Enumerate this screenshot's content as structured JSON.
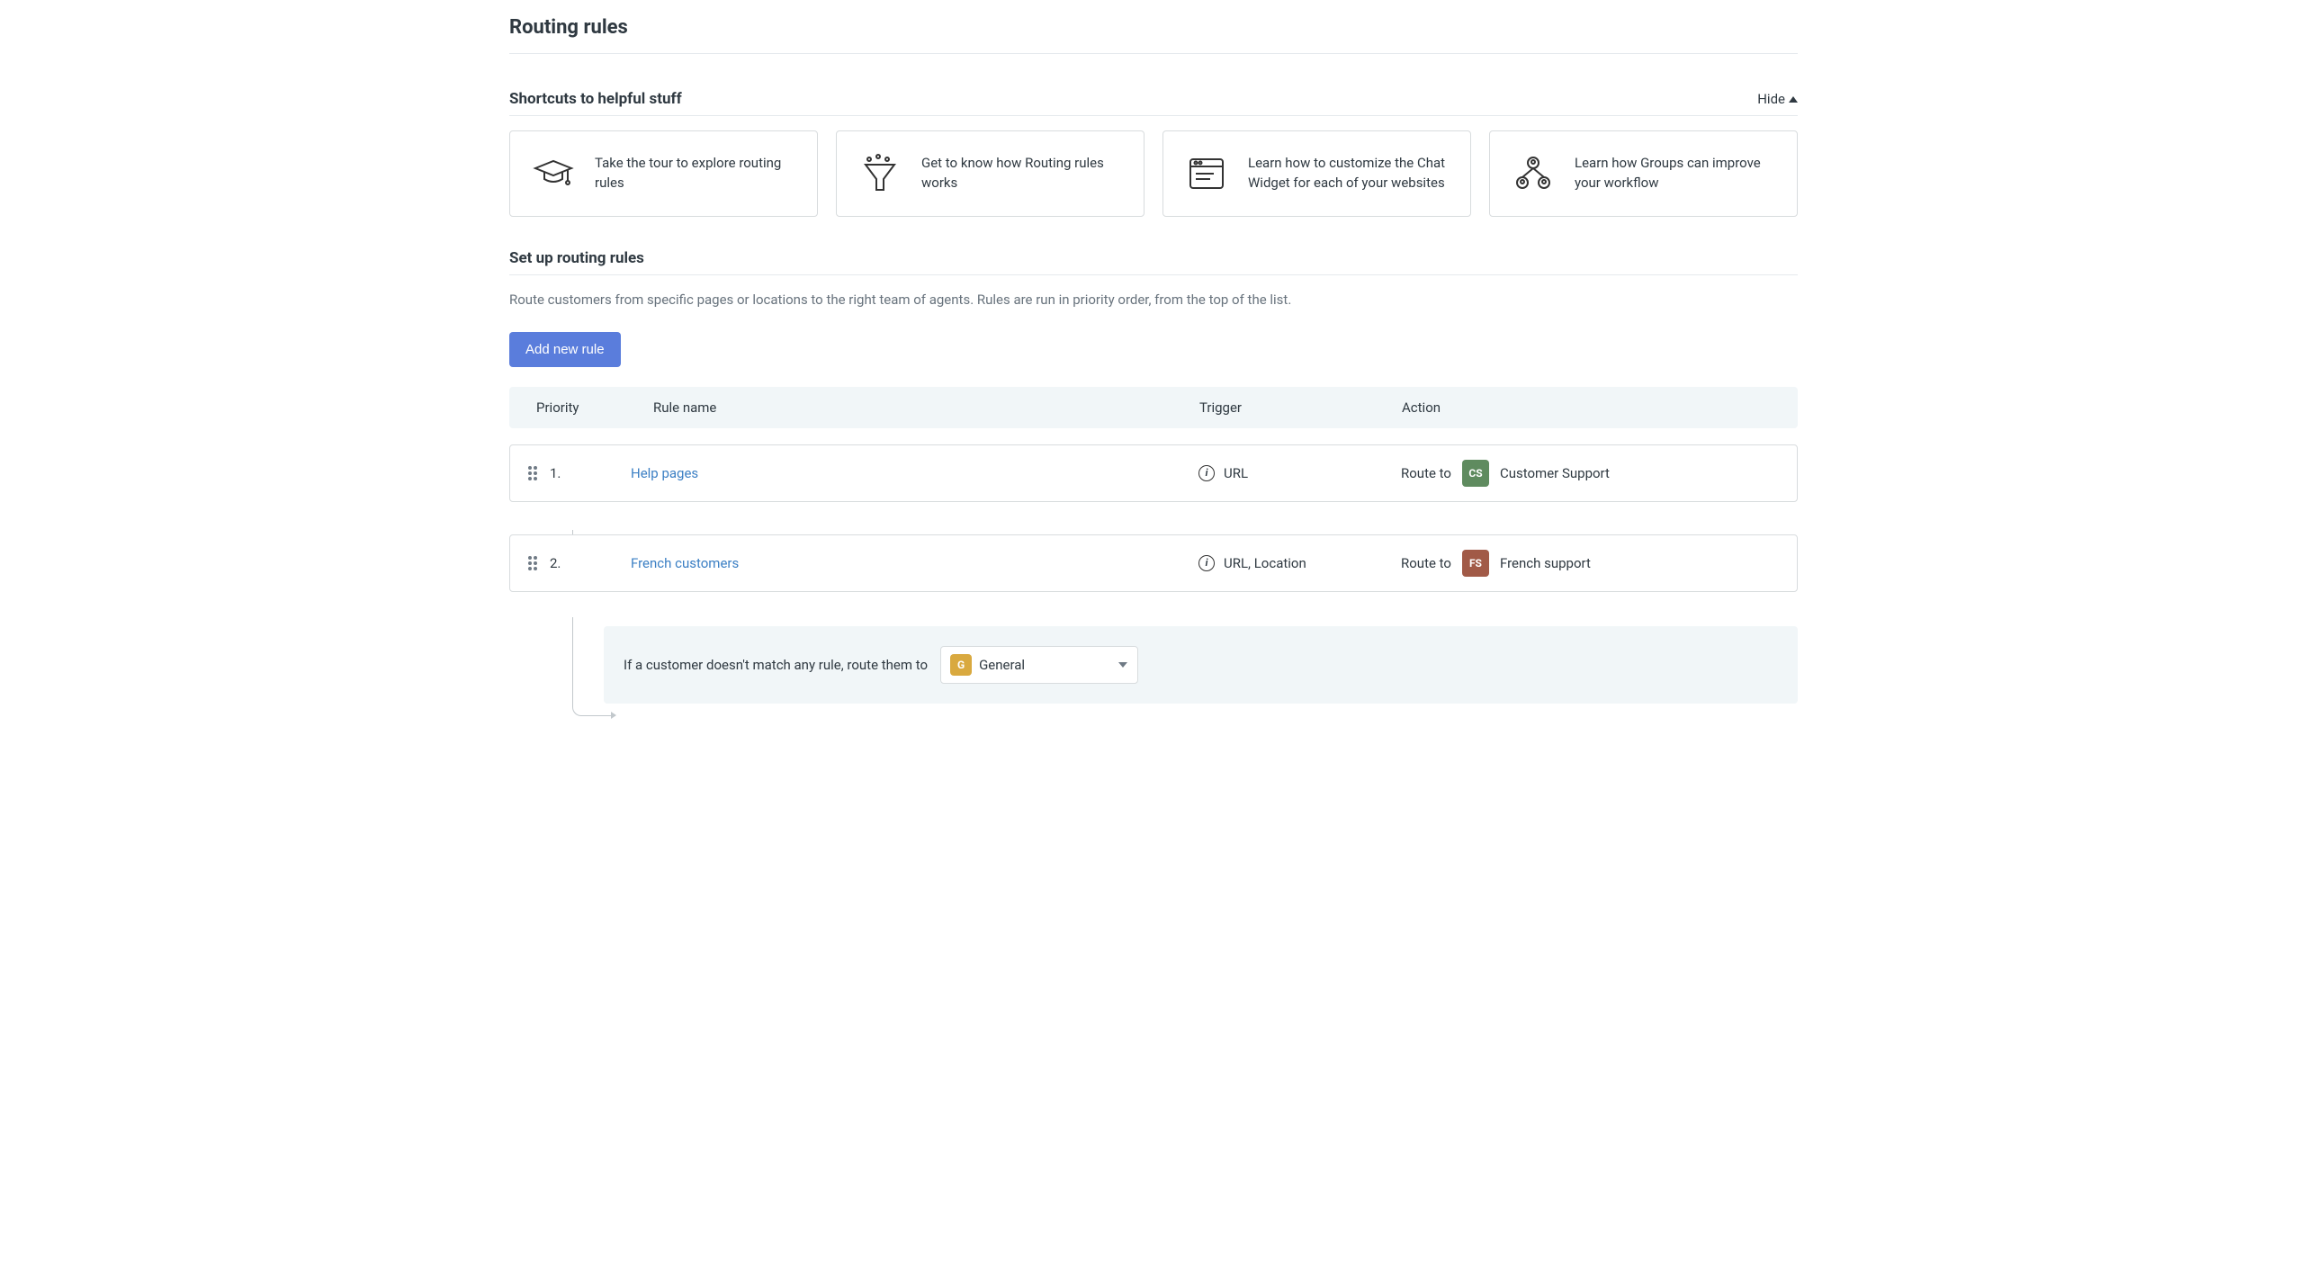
{
  "page_title": "Routing rules",
  "shortcuts": {
    "heading": "Shortcuts to helpful stuff",
    "hide_label": "Hide",
    "cards": [
      {
        "text": "Take the tour to explore routing rules",
        "icon": "graduation-cap-icon"
      },
      {
        "text": "Get to know how Routing rules works",
        "icon": "funnel-icon"
      },
      {
        "text": "Learn how to customize the Chat Widget for each of your websites",
        "icon": "browser-window-icon"
      },
      {
        "text": "Learn how Groups can improve your workflow",
        "icon": "group-hierarchy-icon"
      }
    ]
  },
  "setup": {
    "heading": "Set up routing rules",
    "description": "Route customers from specific pages or locations to the right team of agents. Rules are run in priority order, from the top of the list.",
    "add_button_label": "Add new rule"
  },
  "table": {
    "headers": {
      "priority": "Priority",
      "name": "Rule name",
      "trigger": "Trigger",
      "action": "Action"
    },
    "route_to_label": "Route to",
    "rules": [
      {
        "priority": "1.",
        "name": "Help pages",
        "trigger": "URL",
        "action_group": {
          "initials": "CS",
          "label": "Customer Support",
          "color_class": "badge-cs"
        }
      },
      {
        "priority": "2.",
        "name": "French customers",
        "trigger": "URL, Location",
        "action_group": {
          "initials": "FS",
          "label": "French support",
          "color_class": "badge-fs"
        }
      }
    ]
  },
  "fallback": {
    "text": "If a customer doesn't match any rule, route them to",
    "selected": {
      "initials": "G",
      "label": "General"
    }
  }
}
